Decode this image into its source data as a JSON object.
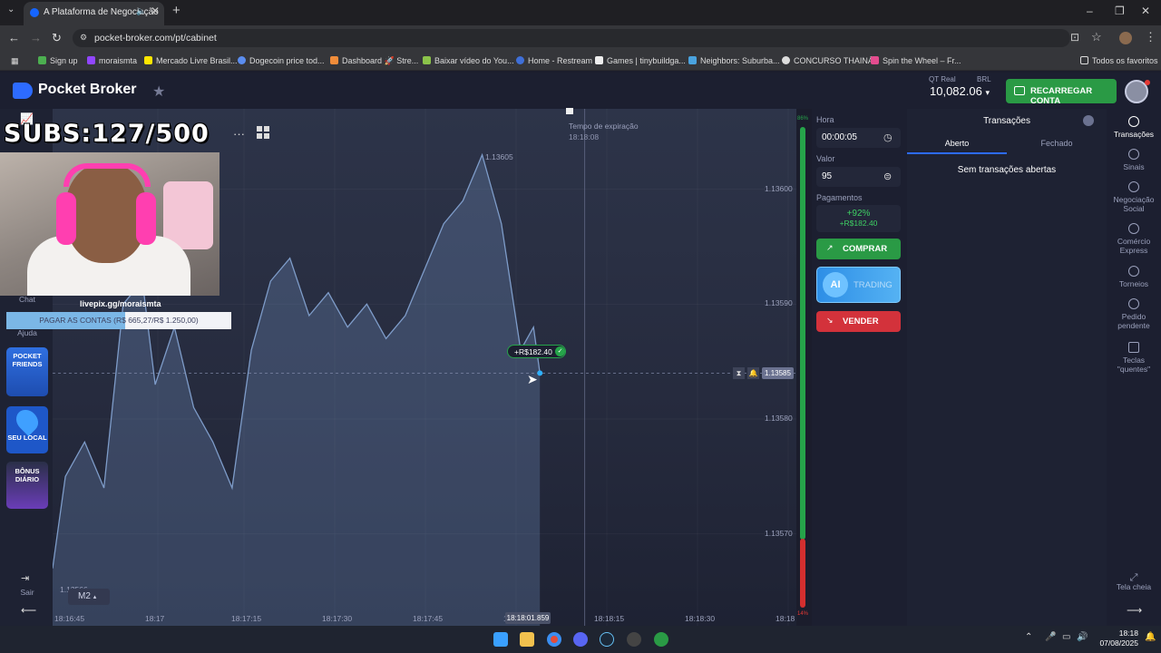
{
  "browser": {
    "tab_title": "A Plataforma de Negociação",
    "url": "pocket-broker.com/pt/cabinet",
    "bookmarks": [
      "Sign up",
      "moraismta",
      "Mercado Livre Brasil...",
      "Dogecoin price tod...",
      "Dashboard 🚀 Stre...",
      "Baixar vídeo do You...",
      "Home - Restream",
      "Games | tinybuildga...",
      "Neighbors: Suburba...",
      "CONCURSO THAINÁ",
      "Spin the Wheel – Fr...",
      "Todos os favoritos"
    ]
  },
  "header": {
    "logo": "Pocket Broker",
    "account_label": "QT Real",
    "currency": "BRL",
    "balance": "10,082.06",
    "recharge_label": "RECARREGAR CONTA"
  },
  "overlay": {
    "subs": "SUBS:127/500",
    "livepix": "livepix.gg/moraismta",
    "goal_text": "PAGAR AS CONTAS (R$ 665,27/R$ 1.250,00)",
    "goal_fraction": 0.532
  },
  "left_sidebar": {
    "chat": "Chat",
    "help": "Ajuda",
    "promo1": "POCKET FRIENDS",
    "promo2": "SEU LOCAL",
    "promo3": "BÔNUS DIÁRIO",
    "logout": "Sair"
  },
  "chart": {
    "timeframe": "M2",
    "expiration_label": "Tempo de expiração",
    "expiration_time": "18:18:08",
    "current_time": "18:18:01.859",
    "current_price": "1.13585",
    "peak_label": "1.13605",
    "profit_tag": "+R$182.40",
    "low_label": "1.13566",
    "pct_top": "86%",
    "pct_bottom": "14%"
  },
  "chart_data": {
    "type": "area",
    "y_ticks": [
      "1.13600",
      "1.13590",
      "1.13580",
      "1.13570"
    ],
    "x_ticks": [
      "18:16:45",
      "18:17",
      "18:17:15",
      "18:17:30",
      "18:17:45",
      "18:18",
      "18:18:15",
      "18:18:30",
      "18:18"
    ],
    "ylim": [
      1.13562,
      1.13607
    ],
    "series": [
      {
        "x": [
          "18:16:45",
          "18:16:47",
          "18:16:50",
          "18:16:53",
          "18:16:56",
          "18:16:59",
          "18:17:01",
          "18:17:04",
          "18:17:07",
          "18:17:10",
          "18:17:13",
          "18:17:16",
          "18:17:19",
          "18:17:22",
          "18:17:25",
          "18:17:28",
          "18:17:31",
          "18:17:34",
          "18:17:37",
          "18:17:40",
          "18:17:43",
          "18:17:46",
          "18:17:49",
          "18:17:52",
          "18:17:55",
          "18:17:58",
          "18:18:00",
          "18:18:01"
        ],
        "values": [
          1.13567,
          1.13575,
          1.13578,
          1.13574,
          1.1359,
          1.13592,
          1.13583,
          1.13588,
          1.13581,
          1.13578,
          1.13574,
          1.13586,
          1.13592,
          1.13594,
          1.13589,
          1.13591,
          1.13588,
          1.1359,
          1.13587,
          1.13589,
          1.13593,
          1.13597,
          1.13599,
          1.13603,
          1.13597,
          1.13586,
          1.13588,
          1.13584
        ]
      }
    ]
  },
  "panel": {
    "time_label": "Hora",
    "time_value": "00:00:05",
    "amount_label": "Valor",
    "amount_value": "95",
    "payout_label": "Pagamentos",
    "payout_pct": "+92%",
    "payout_value": "+R$182.40",
    "buy": "COMPRAR",
    "ai_prefix": "AI",
    "ai_label": "TRADING",
    "sell": "VENDER"
  },
  "transactions": {
    "title": "Transações",
    "tab_open": "Aberto",
    "tab_closed": "Fechado",
    "empty": "Sem transações abertas"
  },
  "right_sidebar": {
    "items": [
      "Transações",
      "Sinais",
      "Negociação Social",
      "Comércio Express",
      "Torneios",
      "Pedido pendente",
      "Teclas \"quentes\""
    ],
    "fullscreen": "Tela cheia"
  },
  "taskbar": {
    "time": "18:18",
    "date": "07/08/2025"
  },
  "colors": {
    "buy": "#2a9a45",
    "sell": "#d3323b",
    "accent": "#2d6bff"
  }
}
